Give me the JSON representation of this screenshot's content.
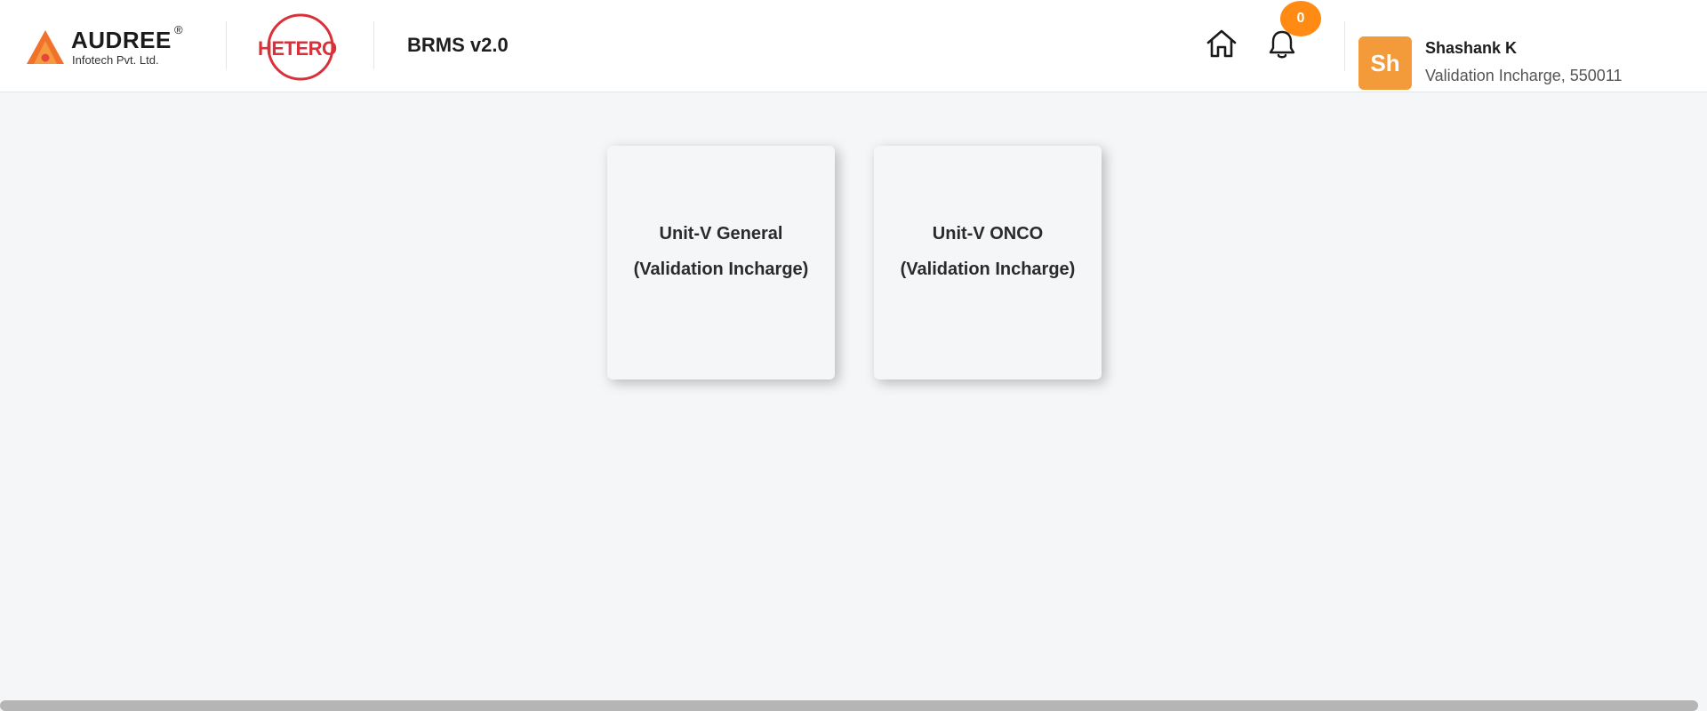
{
  "brand": {
    "company_name": "AUDREE",
    "company_reg_mark": "®",
    "company_subtitle": "Infotech Pvt. Ltd.",
    "partner_name": "HETERO",
    "app_title": "BRMS v2.0",
    "accent_color": "#ff8a14",
    "partner_color": "#d8313a"
  },
  "header": {
    "home_icon": "home-icon",
    "notification_icon": "bell-icon",
    "notification_count": "0"
  },
  "user": {
    "initials": "Sh",
    "name": "Shashank K",
    "role": "Validation Incharge, 550011",
    "avatar_color": "#f39a3a"
  },
  "cards": [
    {
      "line1": "Unit-V General",
      "line2": "(Validation Incharge)"
    },
    {
      "line1": "Unit-V ONCO",
      "line2": "(Validation Incharge)"
    }
  ]
}
